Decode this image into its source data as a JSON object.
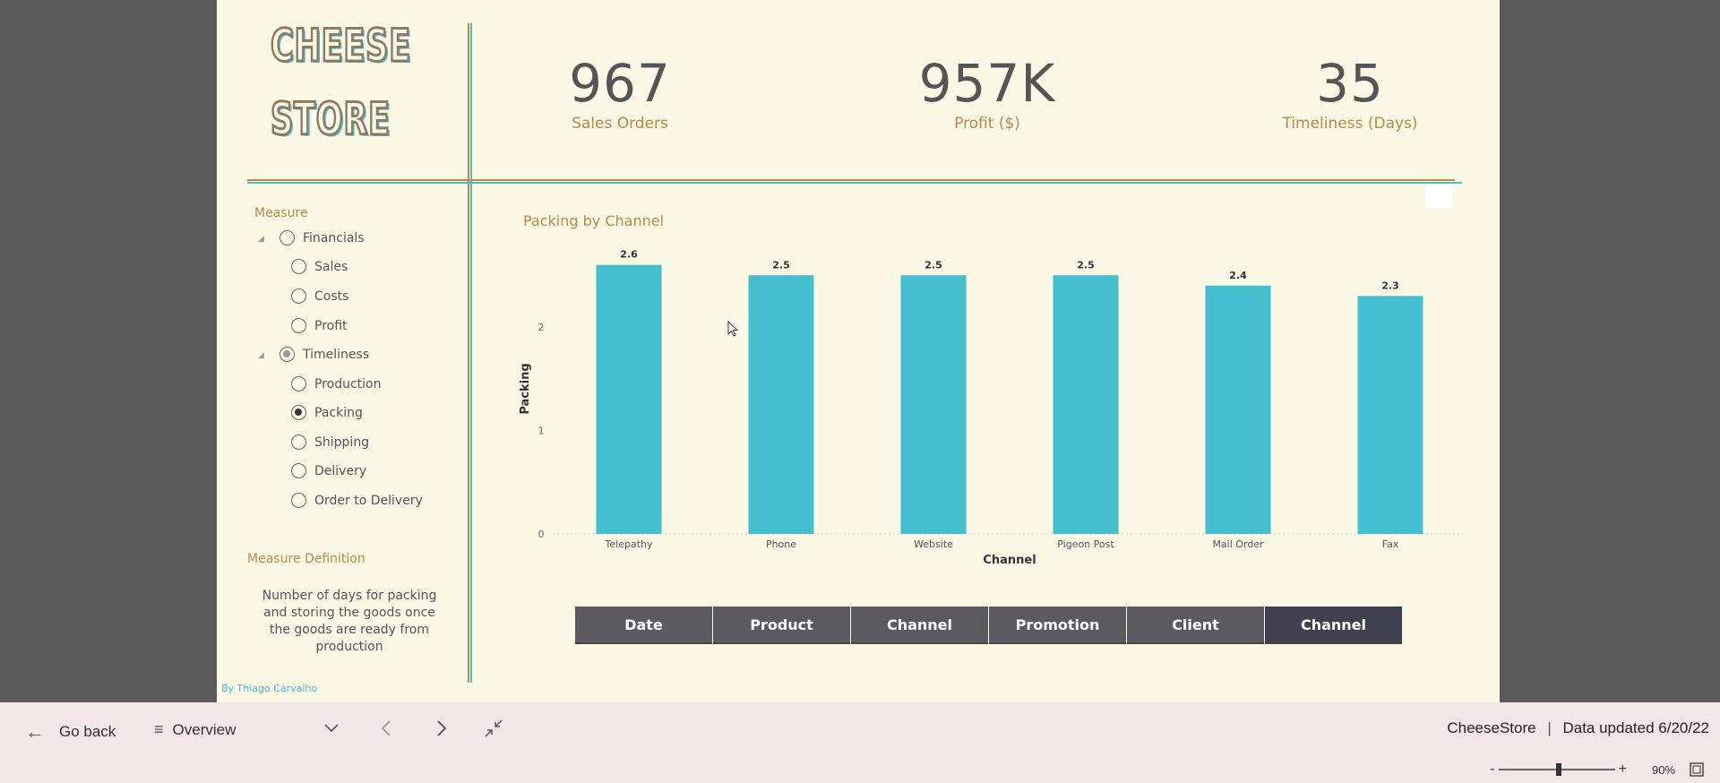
{
  "logo": {
    "line1": "CHEESE",
    "line2": "STORE"
  },
  "kpis": [
    {
      "value": "967",
      "label": "Sales Orders"
    },
    {
      "value": "957K",
      "label": "Profit ($)"
    },
    {
      "value": "35",
      "label": "Timeliness (Days)"
    }
  ],
  "slicer": {
    "title": "Measure",
    "groups": [
      {
        "label": "Financials",
        "state": "off",
        "items": [
          {
            "label": "Sales",
            "selected": false
          },
          {
            "label": "Costs",
            "selected": false
          },
          {
            "label": "Profit",
            "selected": false
          }
        ]
      },
      {
        "label": "Timeliness",
        "state": "partial",
        "items": [
          {
            "label": "Production",
            "selected": false
          },
          {
            "label": "Packing",
            "selected": true
          },
          {
            "label": "Shipping",
            "selected": false
          },
          {
            "label": "Delivery",
            "selected": false
          },
          {
            "label": "Order to Delivery",
            "selected": false
          }
        ]
      }
    ]
  },
  "definition": {
    "title": "Measure Definition",
    "text": "Number of days for packing and storing the goods once the goods are ready from production"
  },
  "byline": "By Thiago Carvalho",
  "chart_title": "Packing by Channel",
  "chart_data": {
    "type": "bar",
    "categories": [
      "Telepathy",
      "Phone",
      "Website",
      "Pigeon Post",
      "Mail Order",
      "Fax"
    ],
    "values": [
      2.6,
      2.5,
      2.5,
      2.5,
      2.4,
      2.3
    ],
    "data_labels": [
      "2.6",
      "2.5",
      "2.5",
      "2.5",
      "2.4",
      "2.3"
    ],
    "title": "Packing by Channel",
    "xlabel": "Channel",
    "ylabel": "Packing",
    "yticks": [
      0,
      1,
      2
    ],
    "ylim": [
      0,
      2.6
    ],
    "grid": false,
    "color": "#45bfce"
  },
  "tabs": [
    {
      "label": "Date",
      "active": false
    },
    {
      "label": "Product",
      "active": false
    },
    {
      "label": "Channel",
      "active": false
    },
    {
      "label": "Promotion",
      "active": false
    },
    {
      "label": "Client",
      "active": false
    },
    {
      "label": "Channel",
      "active": true
    }
  ],
  "bottombar": {
    "go_back": "Go back",
    "page": "Overview",
    "report_name": "CheeseStore",
    "data_updated": "Data updated 6/20/22",
    "zoom": "90%"
  },
  "colors": {
    "accent_teal": "#45bfce",
    "accent_tan": "#b68a4a",
    "canvas": "#fbf8e6",
    "tab": "#5b5b5f",
    "tab_active": "#40414e"
  }
}
